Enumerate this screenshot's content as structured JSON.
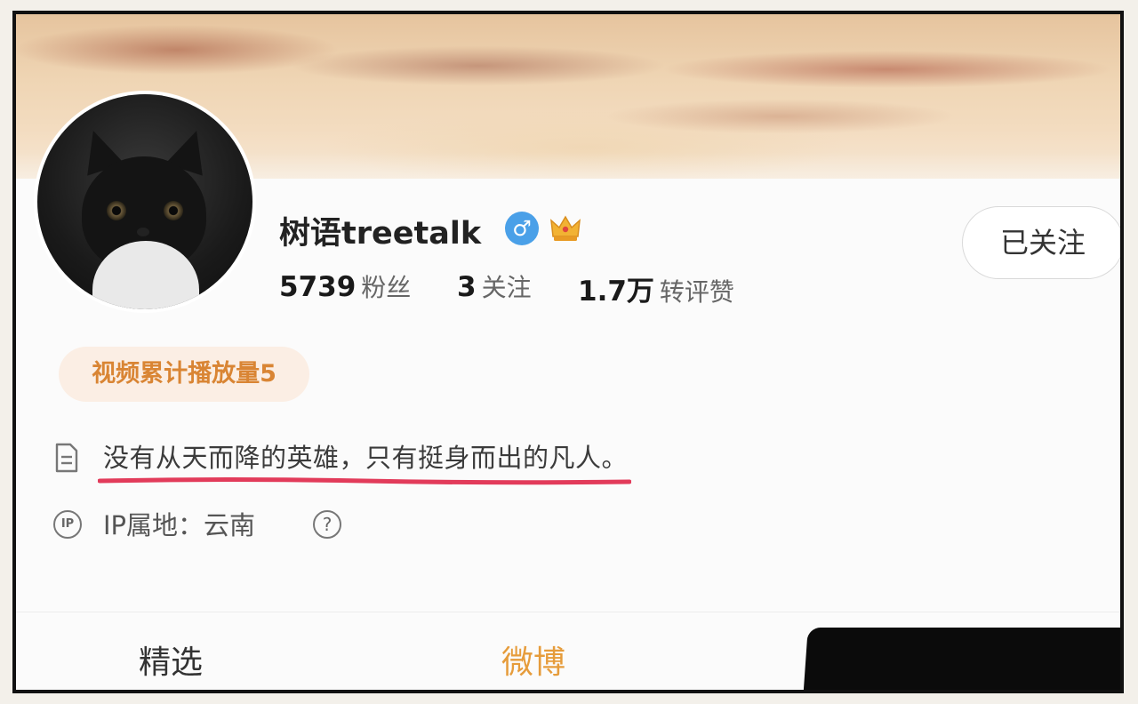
{
  "profile": {
    "username": "树语treetalk",
    "gender_icon": "male-symbol-icon",
    "gender_symbol": "♂",
    "vip_icon": "crown-icon",
    "follow_button": "已关注",
    "stats": [
      {
        "num": "5739",
        "label": "粉丝"
      },
      {
        "num": "3",
        "label": "关注"
      },
      {
        "num": "1.7万",
        "label": "转评赞"
      }
    ],
    "badge": "视频累计播放量5",
    "bio": "没有从天而降的英雄，只有挺身而出的凡人。",
    "bio_icon": "document-icon",
    "ip_icon_text": "IP",
    "ip_location": "IP属地：云南",
    "help_symbol": "?"
  },
  "tabs": [
    {
      "label": "精选",
      "active": false
    },
    {
      "label": "微博",
      "active": true
    }
  ],
  "colors": {
    "accent": "#e69c3b",
    "badge_bg": "#fbeee4",
    "badge_text": "#d98534",
    "underline": "#e23b5a",
    "gender_blue": "#4aa0e8"
  }
}
